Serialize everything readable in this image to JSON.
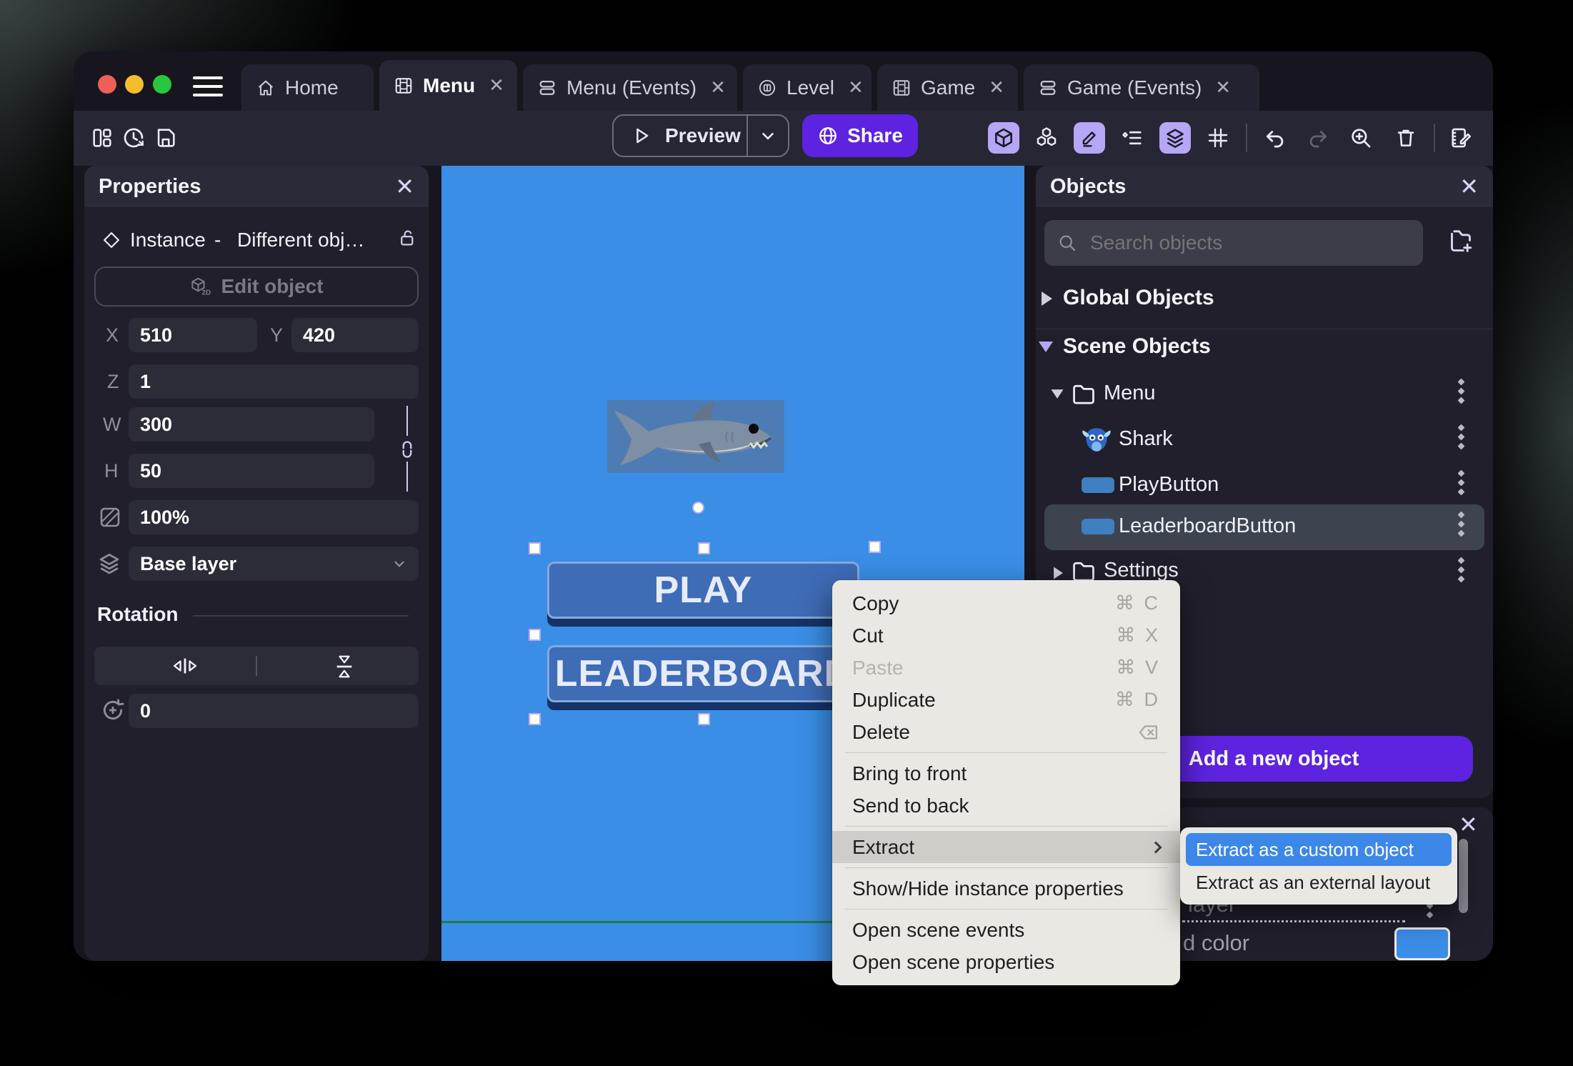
{
  "titlebar": {
    "tabs": [
      {
        "label": "Home",
        "icon": "home-icon",
        "active": false,
        "closable": false
      },
      {
        "label": "Menu",
        "icon": "film-icon",
        "active": true,
        "closable": true
      },
      {
        "label": "Menu (Events)",
        "icon": "events-icon",
        "active": false,
        "closable": true
      },
      {
        "label": "Level",
        "icon": "level-icon",
        "active": false,
        "closable": true
      },
      {
        "label": "Game",
        "icon": "film-icon",
        "active": false,
        "closable": true
      },
      {
        "label": "Game (Events)",
        "icon": "events-icon",
        "active": false,
        "closable": true
      }
    ],
    "close_glyph": "✕"
  },
  "toolbar": {
    "preview_label": "Preview",
    "share_label": "Share"
  },
  "properties_panel": {
    "title": "Properties",
    "close_glyph": "✕",
    "instance_type": "Instance",
    "separator": "-",
    "instance_object": "Different obj…",
    "edit_object_label": "Edit object",
    "fields": {
      "x": {
        "label": "X",
        "value": "510"
      },
      "y": {
        "label": "Y",
        "value": "420"
      },
      "z": {
        "label": "Z",
        "value": "1"
      },
      "w": {
        "label": "W",
        "value": "300"
      },
      "h": {
        "label": "H",
        "value": "50"
      },
      "opacity": {
        "value": "100%"
      },
      "layer": {
        "value": "Base layer"
      }
    },
    "rotation": {
      "title": "Rotation",
      "angle": "0"
    }
  },
  "scene": {
    "play_button": "PLAY",
    "leaderboard_button": "LEADERBOARD"
  },
  "objects_panel": {
    "title": "Objects",
    "close_glyph": "✕",
    "search_placeholder": "Search objects",
    "global_section": "Global Objects",
    "scene_section": "Scene Objects",
    "tree": [
      {
        "label": "Menu",
        "type": "folder",
        "expanded": true
      },
      {
        "label": "Shark",
        "type": "sprite"
      },
      {
        "label": "PlayButton",
        "type": "button"
      },
      {
        "label": "LeaderboardButton",
        "type": "button",
        "selected": true
      },
      {
        "label": "Settings",
        "type": "folder",
        "expanded": false
      }
    ],
    "add_button_label": "Add a new object"
  },
  "layers_panel": {
    "close_glyph": "✕",
    "visible_text_layer": "layer",
    "visible_text_color": "d color"
  },
  "context_menu": {
    "items": [
      {
        "label": "Copy",
        "shortcut": "⌘ C"
      },
      {
        "label": "Cut",
        "shortcut": "⌘ X"
      },
      {
        "label": "Paste",
        "shortcut": "⌘ V",
        "disabled": true
      },
      {
        "label": "Duplicate",
        "shortcut": "⌘ D"
      },
      {
        "label": "Delete",
        "shortcut_icon": "delete-key-icon"
      },
      {
        "label": "Bring to front"
      },
      {
        "label": "Send to back"
      },
      {
        "label": "Extract",
        "has_submenu": true,
        "highlighted": true
      },
      {
        "label": "Show/Hide instance properties"
      },
      {
        "label": "Open scene events"
      },
      {
        "label": "Open scene properties"
      }
    ],
    "submenu": [
      {
        "label": "Extract as a custom object",
        "highlighted": true
      },
      {
        "label": "Extract as an external layout"
      }
    ]
  },
  "colors": {
    "canvas_blue": "#3A8EE6",
    "accent_purple": "#5D23E0",
    "lavender": "#B6A6F5",
    "selection_highlight_blue": "#3C87E8",
    "scene_button_blue": "#3E6CB7",
    "scene_guide_green": "#1F7B45"
  }
}
